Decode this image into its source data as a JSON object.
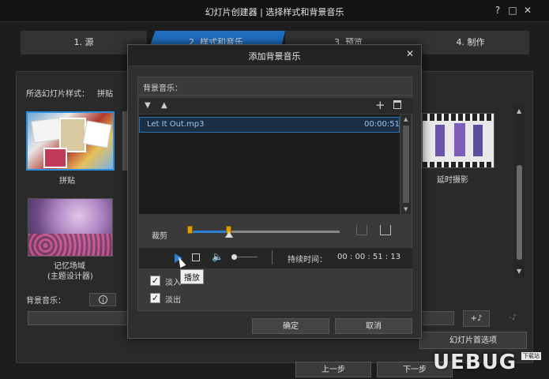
{
  "window": {
    "title": "幻灯片创建器 | 选择样式和背景音乐",
    "controls": [
      "?",
      "□",
      "✕"
    ]
  },
  "steps": [
    {
      "label": "1. 源"
    },
    {
      "label": "2. 样式和音乐"
    },
    {
      "label": "3. 预览"
    },
    {
      "label": "4. 制作"
    }
  ],
  "main": {
    "style_label": "所选幻灯片样式：",
    "style_value": "拼贴",
    "thumbs": [
      {
        "caption": "拼贴"
      },
      {
        "caption": "延时摄影"
      },
      {
        "caption_line1": "记忆场域",
        "caption_line2": "(主题设计器)"
      }
    ],
    "bg_music_label": "背景音乐：",
    "info_icon": "i",
    "music_add_icon": "+♪",
    "music_remove_icon": "-♪",
    "prefs_button": "幻灯片首选项",
    "prev_button": "上一步",
    "next_button": "下一步",
    "watermark": "UEBUG",
    "watermark_sub": "下载站"
  },
  "dialog": {
    "title": "添加背景音乐",
    "section_label": "背景音乐：",
    "track": {
      "name": "Let It Out.mp3",
      "duration": "00:00:51"
    },
    "trim_label": "裁剪",
    "duration_label": "持续时间：",
    "duration_value": "00 : 00 : 51 : 13",
    "tooltip": "播放",
    "fade_in": {
      "label": "淡入",
      "checked": true
    },
    "fade_out": {
      "label": "淡出",
      "checked": true
    },
    "ok": "确定",
    "cancel": "取消",
    "colors": {
      "accent": "#2b7fd4",
      "handle": "#e0a200"
    }
  }
}
